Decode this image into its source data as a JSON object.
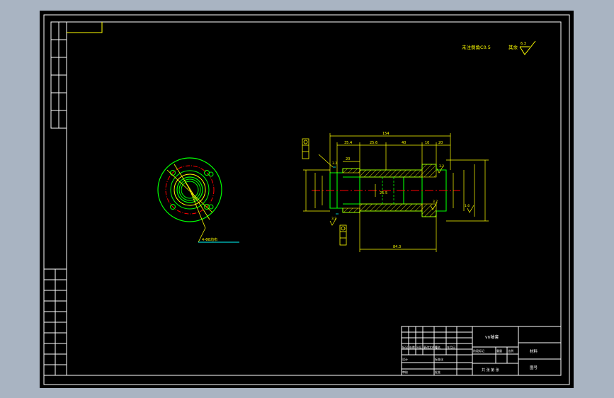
{
  "canvas": {
    "background_color": "#a9b4c2",
    "sheet_color": "#000000",
    "border_color": "#ffffff"
  },
  "colors": {
    "yellow": "#ffff00",
    "green": "#00ff00",
    "red": "#ff0000",
    "white": "#ffffff",
    "cyan": "#00ffff"
  },
  "notes": {
    "tolerance_note": "未注倒角C0.5",
    "roughness_prefix": "其余",
    "roughness_value": "6.3"
  },
  "end_view": {
    "leader_label": "4-Φ8均布"
  },
  "section_view": {
    "dim_top_total": "154",
    "dim_top_segments": [
      "35.4",
      "25.6",
      "40",
      "10",
      "20"
    ],
    "dim_top_left": "20",
    "dim_bottom": "84.3",
    "dim_center": "25.5",
    "roughness_marks": [
      "3.2",
      "3.2",
      "3.2",
      "3.2",
      "1.6"
    ]
  },
  "title_block": {
    "part_name": "vn轴套",
    "material_label": "材料",
    "scale_label": "比例",
    "drawing_no_label": "图号",
    "sheet_label": "共 张 第 张",
    "header_cells": [
      "标记",
      "处数",
      "分区",
      "更改文件号",
      "签名",
      "年月日"
    ],
    "left_cells": [
      "设计",
      "审核"
    ],
    "mid_cells": [
      "标准化",
      "批准"
    ],
    "stage_cells": [
      "阶段标记",
      "重量",
      "比例"
    ]
  }
}
